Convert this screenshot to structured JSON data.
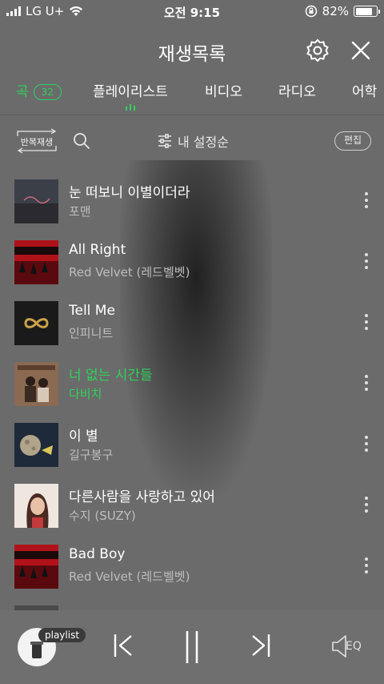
{
  "status_bar": {
    "carrier": "LG U+",
    "time": "오전 9:15",
    "battery": "82%",
    "battery_level": 0.82
  },
  "header": {
    "title": "재생목록"
  },
  "tabs": [
    {
      "label": "곡",
      "badge": "32",
      "active": true
    },
    {
      "label": "플레이리스트",
      "active": false
    },
    {
      "label": "비디오",
      "active": false
    },
    {
      "label": "라디오",
      "active": false
    },
    {
      "label": "어학",
      "active": false
    }
  ],
  "toolbar": {
    "repeat_label": "반복재생",
    "sort_label": "내 설정순",
    "edit_label": "편집"
  },
  "songs": [
    {
      "title": "눈 떠보니 이별이더라",
      "artist": "포맨",
      "playing": false,
      "cover": "cover-foman"
    },
    {
      "title": "All Right",
      "artist": "Red Velvet (레드벨벳)",
      "playing": false,
      "cover": "cover-redvelvet"
    },
    {
      "title": "Tell Me",
      "artist": "인피니트",
      "playing": false,
      "cover": "cover-infinite"
    },
    {
      "title": "너 없는 시간들",
      "artist": "다비치",
      "playing": true,
      "cover": "cover-davichi"
    },
    {
      "title": "이 별",
      "artist": "길구봉구",
      "playing": false,
      "cover": "cover-gilgu"
    },
    {
      "title": "다른사람을 사랑하고 있어",
      "artist": "수지 (SUZY)",
      "playing": false,
      "cover": "cover-suzy"
    },
    {
      "title": "Bad Boy",
      "artist": "Red Velvet (레드벨벳)",
      "playing": false,
      "cover": "cover-redvelvet"
    }
  ],
  "player": {
    "playlist_tag": "playlist",
    "eq_label": "EQ"
  },
  "colors": {
    "accent": "#2fd25b",
    "background": "#6b6b6b"
  }
}
